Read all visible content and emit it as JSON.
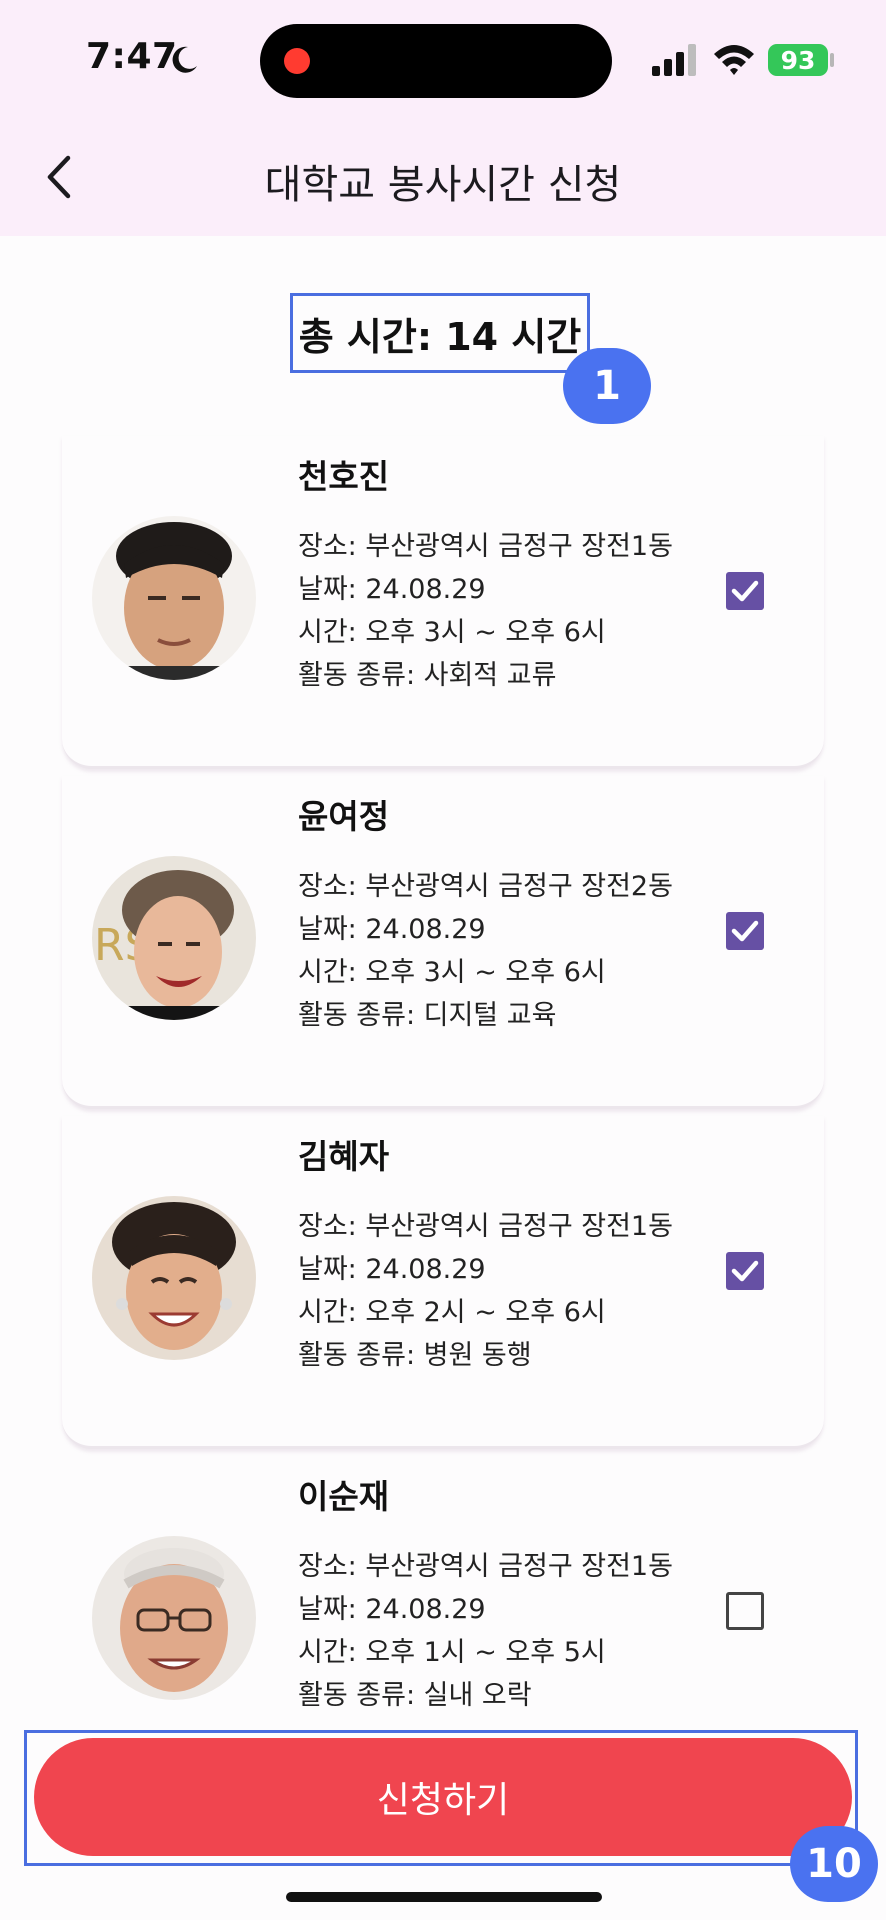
{
  "status_bar": {
    "time": "7:47",
    "battery": "93"
  },
  "header": {
    "title": "대학교 봉사시간 신청"
  },
  "summary": {
    "total": "총 시간: 14 시간"
  },
  "annotations": {
    "badge1": "1",
    "badge2": "10"
  },
  "cards": [
    {
      "name": "천호진",
      "place": "장소: 부산광역시 금정구 장전1동",
      "date": "날짜: 24.08.29",
      "time": "시간: 오후 3시 ~ 오후 6시",
      "type": "활동 종류: 사회적 교류",
      "checked": true
    },
    {
      "name": "윤여정",
      "place": "장소: 부산광역시 금정구 장전2동",
      "date": "날짜: 24.08.29",
      "time": "시간: 오후 3시 ~ 오후 6시",
      "type": "활동 종류: 디지털 교육",
      "checked": true
    },
    {
      "name": "김혜자",
      "place": "장소: 부산광역시 금정구 장전1동",
      "date": "날짜: 24.08.29",
      "time": "시간: 오후 2시 ~ 오후 6시",
      "type": "활동 종류: 병원 동행",
      "checked": true
    },
    {
      "name": "이순재",
      "place": "장소: 부산광역시 금정구 장전1동",
      "date": "날짜: 24.08.29",
      "time": "시간: 오후 1시 ~ 오후 5시",
      "type": "활동 종류: 실내 오락",
      "checked": false
    }
  ],
  "submit": {
    "label": "신청하기"
  },
  "colors": {
    "header_bg": "#fbeefa",
    "checkbox": "#6650a4",
    "submit": "#f0454f",
    "annotation": "#4a72f0"
  }
}
